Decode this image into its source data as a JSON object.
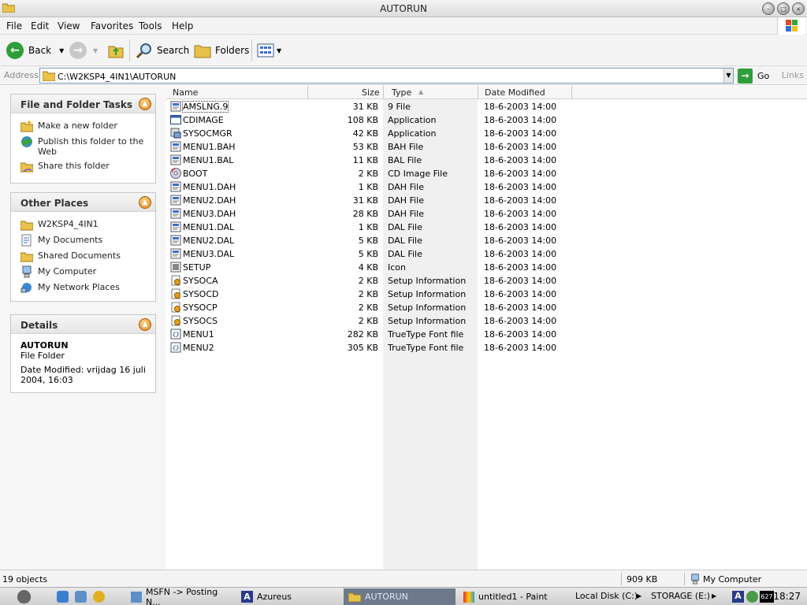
{
  "window": {
    "title": "AUTORUN"
  },
  "menu": [
    "File",
    "Edit",
    "View",
    "Favorites",
    "Tools",
    "Help"
  ],
  "toolbar": {
    "back": "Back",
    "search": "Search",
    "folders": "Folders"
  },
  "address": {
    "label": "Address",
    "value": "C:\\W2KSP4_4IN1\\AUTORUN",
    "go": "Go",
    "links": "Links"
  },
  "tasks_panel": {
    "title": "File and Folder Tasks",
    "items": [
      "Make a new folder",
      "Publish this folder to the Web",
      "Share this folder"
    ]
  },
  "places_panel": {
    "title": "Other Places",
    "items": [
      "W2KSP4_4IN1",
      "My Documents",
      "Shared Documents",
      "My Computer",
      "My Network Places"
    ]
  },
  "details_panel": {
    "title": "Details",
    "name": "AUTORUN",
    "kind": "File Folder",
    "modified": "Date Modified: vrijdag 16 juli 2004, 16:03"
  },
  "columns": {
    "name": "Name",
    "size": "Size",
    "type": "Type",
    "date": "Date Modified"
  },
  "files": [
    {
      "name": "AMSLNG.9",
      "size": "31 KB",
      "type": "9 File",
      "date": "18-6-2003 14:00",
      "icon": "generic-file-icon"
    },
    {
      "name": "CDIMAGE",
      "size": "108 KB",
      "type": "Application",
      "date": "18-6-2003 14:00",
      "icon": "application-icon"
    },
    {
      "name": "SYSOCMGR",
      "size": "42 KB",
      "type": "Application",
      "date": "18-6-2003 14:00",
      "icon": "setup-application-icon"
    },
    {
      "name": "MENU1.BAH",
      "size": "53 KB",
      "type": "BAH File",
      "date": "18-6-2003 14:00",
      "icon": "generic-file-icon"
    },
    {
      "name": "MENU1.BAL",
      "size": "11 KB",
      "type": "BAL File",
      "date": "18-6-2003 14:00",
      "icon": "generic-file-icon"
    },
    {
      "name": "BOOT",
      "size": "2 KB",
      "type": "CD Image File",
      "date": "18-6-2003 14:00",
      "icon": "cd-image-icon"
    },
    {
      "name": "MENU1.DAH",
      "size": "1 KB",
      "type": "DAH File",
      "date": "18-6-2003 14:00",
      "icon": "generic-file-icon"
    },
    {
      "name": "MENU2.DAH",
      "size": "31 KB",
      "type": "DAH File",
      "date": "18-6-2003 14:00",
      "icon": "generic-file-icon"
    },
    {
      "name": "MENU3.DAH",
      "size": "28 KB",
      "type": "DAH File",
      "date": "18-6-2003 14:00",
      "icon": "generic-file-icon"
    },
    {
      "name": "MENU1.DAL",
      "size": "1 KB",
      "type": "DAL File",
      "date": "18-6-2003 14:00",
      "icon": "generic-file-icon"
    },
    {
      "name": "MENU2.DAL",
      "size": "5 KB",
      "type": "DAL File",
      "date": "18-6-2003 14:00",
      "icon": "generic-file-icon"
    },
    {
      "name": "MENU3.DAL",
      "size": "5 KB",
      "type": "DAL File",
      "date": "18-6-2003 14:00",
      "icon": "generic-file-icon"
    },
    {
      "name": "SETUP",
      "size": "4 KB",
      "type": "Icon",
      "date": "18-6-2003 14:00",
      "icon": "icon-file-icon"
    },
    {
      "name": "SYSOCA",
      "size": "2 KB",
      "type": "Setup Information",
      "date": "18-6-2003 14:00",
      "icon": "setup-info-icon"
    },
    {
      "name": "SYSOCD",
      "size": "2 KB",
      "type": "Setup Information",
      "date": "18-6-2003 14:00",
      "icon": "setup-info-icon"
    },
    {
      "name": "SYSOCP",
      "size": "2 KB",
      "type": "Setup Information",
      "date": "18-6-2003 14:00",
      "icon": "setup-info-icon"
    },
    {
      "name": "SYSOCS",
      "size": "2 KB",
      "type": "Setup Information",
      "date": "18-6-2003 14:00",
      "icon": "setup-info-icon"
    },
    {
      "name": "MENU1",
      "size": "282 KB",
      "type": "TrueType Font file",
      "date": "18-6-2003 14:00",
      "icon": "font-file-icon"
    },
    {
      "name": "MENU2",
      "size": "305 KB",
      "type": "TrueType Font file",
      "date": "18-6-2003 14:00",
      "icon": "font-file-icon"
    }
  ],
  "status": {
    "objects": "19 objects",
    "size": "909 KB",
    "location": "My Computer"
  },
  "taskbar": {
    "tasks": [
      "MSFN -> Posting N...",
      "Azureus",
      "AUTORUN",
      "untitled1 - Paint"
    ],
    "drives": [
      "Local Disk (C:)",
      "STORAGE (E:)"
    ],
    "tray_badge": "627",
    "clock": "18:27"
  }
}
